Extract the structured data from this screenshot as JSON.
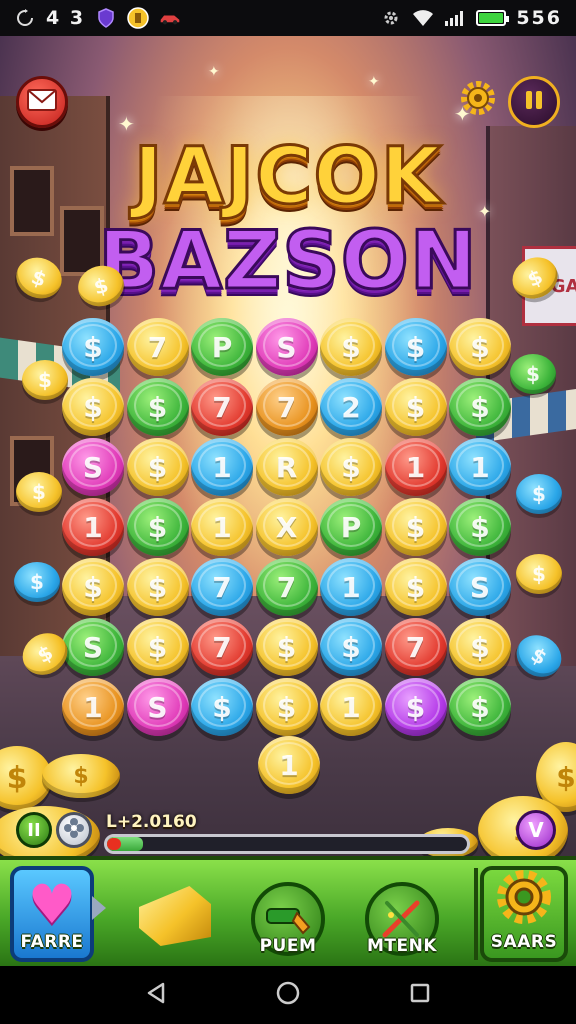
{
  "status_bar": {
    "left_digits": "4 3",
    "time": "556",
    "icons": [
      "sync-icon",
      "shield-icon",
      "coin-app-icon",
      "car-icon",
      "settings-icon",
      "wifi-icon",
      "signal-icon",
      "battery-icon"
    ]
  },
  "game": {
    "title_line1": "JAJCOK",
    "title_line2": "BAZSON",
    "store_sign": "INGAN",
    "score": "L+2.0160",
    "progress_fraction": 0.1,
    "mini_pause_label": "II",
    "badge_label": "V",
    "grid": [
      [
        {
          "c": "blue",
          "t": "$"
        },
        {
          "c": "gold",
          "t": "7"
        },
        {
          "c": "green",
          "t": "P"
        },
        {
          "c": "pink",
          "t": "S"
        },
        {
          "c": "gold",
          "t": "$"
        },
        {
          "c": "blue",
          "t": "$"
        },
        {
          "c": "gold",
          "t": "$"
        }
      ],
      [
        {
          "c": "gold",
          "t": "$"
        },
        {
          "c": "green",
          "t": "$"
        },
        {
          "c": "red",
          "t": "7"
        },
        {
          "c": "orange",
          "t": "7"
        },
        {
          "c": "blue",
          "t": "2"
        },
        {
          "c": "gold",
          "t": "$"
        },
        {
          "c": "green",
          "t": "$"
        }
      ],
      [
        {
          "c": "pink",
          "t": "S"
        },
        {
          "c": "gold",
          "t": "$"
        },
        {
          "c": "blue",
          "t": "1"
        },
        {
          "c": "gold",
          "t": "R"
        },
        {
          "c": "gold",
          "t": "$"
        },
        {
          "c": "red",
          "t": "1"
        },
        {
          "c": "blue",
          "t": "1"
        }
      ],
      [
        {
          "c": "red",
          "t": "1"
        },
        {
          "c": "green",
          "t": "$"
        },
        {
          "c": "gold",
          "t": "1"
        },
        {
          "c": "gold",
          "t": "X"
        },
        {
          "c": "green",
          "t": "P"
        },
        {
          "c": "gold",
          "t": "$"
        },
        {
          "c": "green",
          "t": "$"
        }
      ],
      [
        {
          "c": "gold",
          "t": "$"
        },
        {
          "c": "gold",
          "t": "$"
        },
        {
          "c": "blue",
          "t": "7"
        },
        {
          "c": "green",
          "t": "7"
        },
        {
          "c": "blue",
          "t": "1"
        },
        {
          "c": "gold",
          "t": "$"
        },
        {
          "c": "blue",
          "t": "S"
        }
      ],
      [
        {
          "c": "green",
          "t": "S"
        },
        {
          "c": "gold",
          "t": "$"
        },
        {
          "c": "red",
          "t": "7"
        },
        {
          "c": "gold",
          "t": "$"
        },
        {
          "c": "blue",
          "t": "$"
        },
        {
          "c": "red",
          "t": "7"
        },
        {
          "c": "gold",
          "t": "$"
        }
      ],
      [
        {
          "c": "orange",
          "t": "1"
        },
        {
          "c": "pink",
          "t": "S"
        },
        {
          "c": "blue",
          "t": "$"
        },
        {
          "c": "gold",
          "t": "$"
        },
        {
          "c": "gold",
          "t": "1"
        },
        {
          "c": "purple",
          "t": "$"
        },
        {
          "c": "green",
          "t": "$"
        }
      ]
    ],
    "falling_coin": {
      "c": "gold",
      "t": "1"
    }
  },
  "actions": {
    "favorite_label": "FARRE",
    "push_label": "PUEM",
    "mtenk_label": "MTENK",
    "saars_label": "SAARS"
  },
  "colors": {
    "action_bar": "#4aa828",
    "title_gold": "#ffd23a",
    "title_purple": "#c25ef0"
  }
}
